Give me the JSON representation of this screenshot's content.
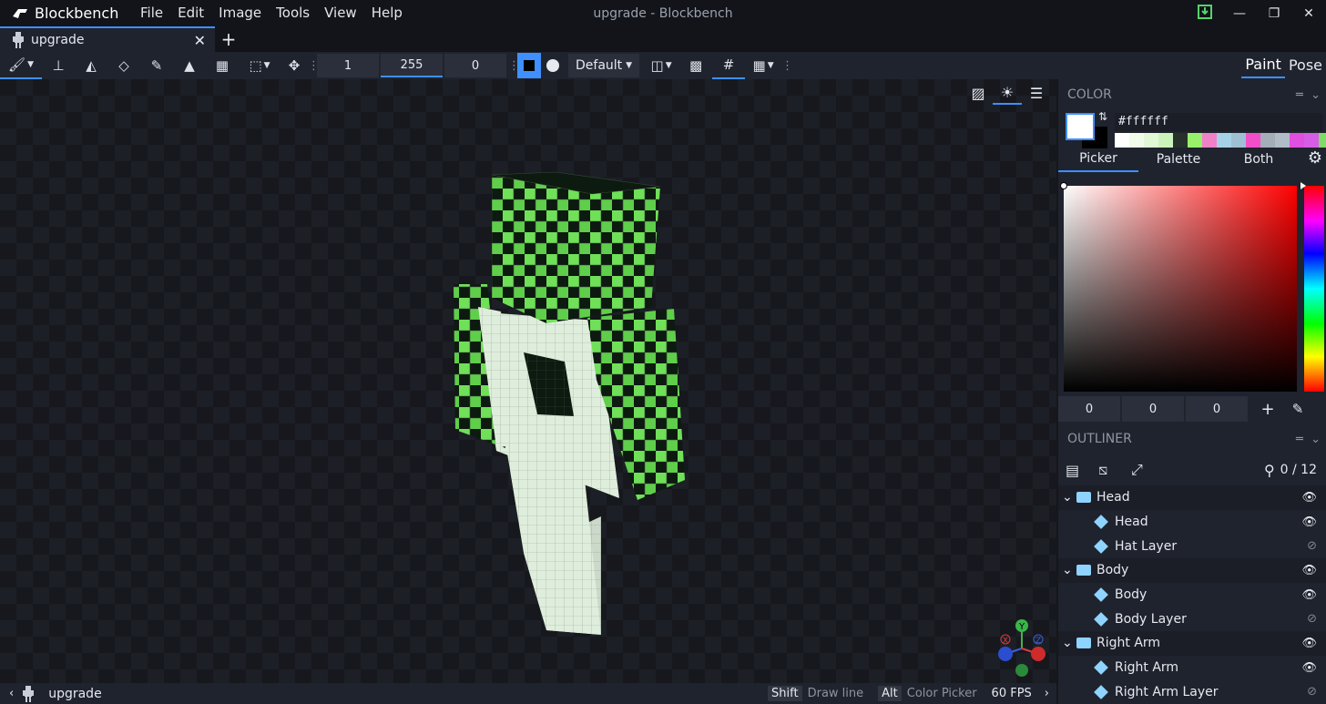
{
  "app": {
    "name": "Blockbench",
    "window_title": "upgrade - Blockbench",
    "menu": [
      "File",
      "Edit",
      "Image",
      "Tools",
      "View",
      "Help"
    ]
  },
  "tabs": [
    {
      "label": "upgrade"
    }
  ],
  "toolbar": {
    "fields": [
      "1",
      "255",
      "0"
    ],
    "dropdown": "Default",
    "modes": [
      "Paint",
      "Pose"
    ]
  },
  "color_panel": {
    "title": "COLOR",
    "hex": "#ffffff",
    "recent_colors": [
      "#ffffff",
      "#f0fbe9",
      "#e0f8d6",
      "#ccf3bc",
      "#27302a",
      "#98f16a",
      "#f081c8",
      "#a6d2e8",
      "#9fc0d3",
      "#f04fc9",
      "#a3aeb8",
      "#b2bcc6",
      "#e04fe0",
      "#d65ee6",
      "#e487e7",
      "#81d969"
    ],
    "tabs": [
      "Picker",
      "Palette",
      "Both"
    ],
    "rgb": [
      "0",
      "0",
      "0"
    ]
  },
  "outliner": {
    "title": "OUTLINER",
    "count": "0 / 12",
    "rows": [
      {
        "label": "Head",
        "type": "group",
        "visible": true
      },
      {
        "label": "Head",
        "type": "cube",
        "visible": true
      },
      {
        "label": "Hat Layer",
        "type": "cube",
        "visible": false
      },
      {
        "label": "Body",
        "type": "group",
        "visible": true
      },
      {
        "label": "Body",
        "type": "cube",
        "visible": true
      },
      {
        "label": "Body Layer",
        "type": "cube",
        "visible": false
      },
      {
        "label": "Right Arm",
        "type": "group",
        "visible": true
      },
      {
        "label": "Right Arm",
        "type": "cube",
        "visible": true
      },
      {
        "label": "Right Arm Layer",
        "type": "cube",
        "visible": false
      }
    ]
  },
  "status": {
    "project": "upgrade",
    "shift_key": "Shift",
    "shift_hint": "Draw line",
    "alt_key": "Alt",
    "alt_hint": "Color Picker",
    "fps": "60 FPS"
  },
  "gizmo": {
    "y": "Y",
    "x": "X",
    "z": "Z"
  },
  "colors": {
    "accent": "#3e90ff",
    "green": "#6fe058",
    "skin_white": "#dfeedc",
    "skin_dark": "#0d1a10"
  }
}
